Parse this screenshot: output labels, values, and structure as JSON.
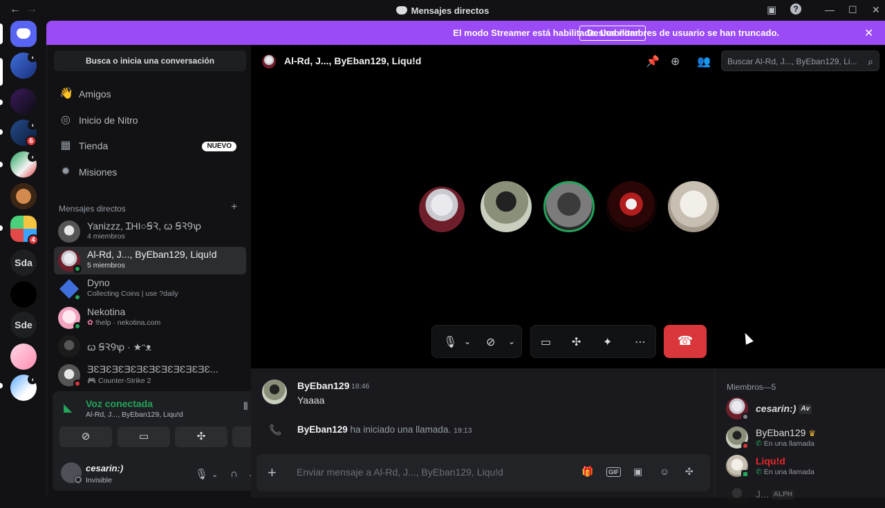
{
  "titlebar": {
    "back_icon": "arrow-left-icon",
    "forward_icon": "arrow-right-icon",
    "title": "Mensajes directos",
    "inbox_icon": "inbox-icon",
    "help_icon": "help-icon",
    "minimize": "—",
    "maximize": "☐",
    "close": "✕"
  },
  "banner": {
    "text": "El modo Streamer está habilitado. Los nombres de usuario se han truncado.",
    "button": "Deshabilitar",
    "close": "✕"
  },
  "rail": {
    "servers": [
      {
        "kind": "home"
      },
      {
        "kind": "avatar",
        "speaker": true
      },
      {
        "kind": "avatar"
      },
      {
        "kind": "avatar",
        "speaker": true,
        "badge": "6"
      },
      {
        "kind": "avatar",
        "speaker": true
      },
      {
        "kind": "avatar"
      },
      {
        "kind": "folder",
        "badge": "4"
      },
      {
        "kind": "text",
        "label": "Sda"
      },
      {
        "kind": "avatar"
      },
      {
        "kind": "text",
        "label": "Sde"
      },
      {
        "kind": "avatar"
      },
      {
        "kind": "avatar",
        "speaker": true
      }
    ]
  },
  "sidebar": {
    "search_label": "Busca o inicia una conversación",
    "nav": [
      {
        "label": "Amigos",
        "icon": "friends-icon"
      },
      {
        "label": "Inicio de Nitro",
        "icon": "nitro-icon"
      },
      {
        "label": "Tienda",
        "icon": "shop-icon",
        "badge": "NUEVO"
      },
      {
        "label": "Misiones",
        "icon": "quests-icon"
      }
    ],
    "dm_header": "Mensajes directos",
    "dm_add": "+",
    "dms": [
      {
        "name": "Yanizzz, ꞮHI○ꞨꝚ, ꞷ ꞨꝚꝮꝕ",
        "sub": "4 miembros"
      },
      {
        "name": "Al-Rd, J..., ByEban129, Liqu!d",
        "sub": "5 miembros",
        "active": true
      },
      {
        "name": "Dyno",
        "sub": "Collecting Coins | use ?daily"
      },
      {
        "name": "Nekotina",
        "sub": "!help · nekotina.com"
      },
      {
        "name": "ꞷ ꞨꝚꝮꝕ · ★ᵔᴥ",
        "sub": ""
      },
      {
        "name": "ƎƐƎƐƎƐƎƐƎƐƎƐƎƐƎƐƎƐƎƐ...",
        "sub": "Counter-Strike 2"
      }
    ]
  },
  "userpanel": {
    "voice_title": "Voz conectada",
    "voice_sub": "Al-Rd, J..., ByEban129, Liqu!d",
    "me_name": "cesarin:)",
    "me_status": "Invisible"
  },
  "main": {
    "title": "Al-Rd, J..., ByEban129, Liqu!d",
    "search_placeholder": "Buscar Al-Rd, J..., ByEban129, Li...",
    "participants": 5
  },
  "chat": {
    "author": "ByEban129",
    "time": "18:46",
    "text": "Yaaaa",
    "call_author": "ByEban129",
    "call_text": " ha iniciado una llamada.",
    "call_time": "19:13",
    "placeholder": "Enviar mensaje a Al-Rd, J..., ByEban129, Liqu!d",
    "gif_label": "GIF"
  },
  "members": {
    "title": "Miembros—5",
    "list": [
      {
        "name": "cesarin:)",
        "tag": "Av",
        "sub": ""
      },
      {
        "name": "ByEban129",
        "sub": "En una llamada"
      },
      {
        "name": "Liqu!d",
        "sub": "En una llamada"
      },
      {
        "name": "J...",
        "tag": "ALPH",
        "sub": ""
      }
    ]
  },
  "colors": {
    "accent": "#9b4bf5",
    "online": "#23a55a",
    "danger": "#da373c",
    "idle": "#f0b232"
  }
}
